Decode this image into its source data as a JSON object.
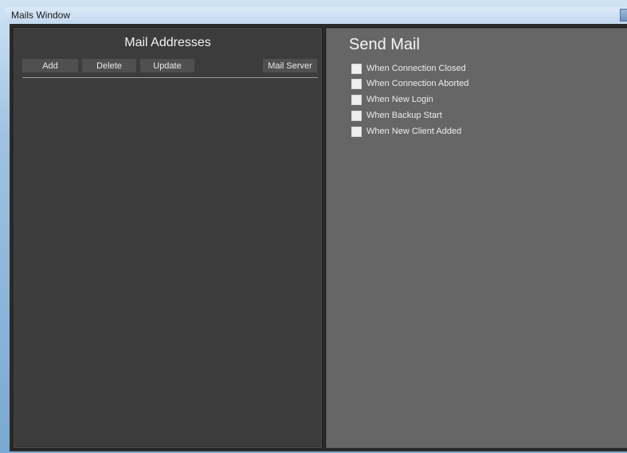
{
  "window": {
    "title": "Mails Window"
  },
  "mail_addresses": {
    "title": "Mail Addresses",
    "buttons": {
      "add": "Add",
      "delete": "Delete",
      "update": "Update",
      "mail_server": "Mail Server"
    },
    "items": []
  },
  "send_mail": {
    "title": "Send Mail",
    "options": [
      {
        "label": "When Connection Closed",
        "checked": false
      },
      {
        "label": "When Connection Aborted",
        "checked": false
      },
      {
        "label": "When New Login",
        "checked": false
      },
      {
        "label": "When Backup Start",
        "checked": false
      },
      {
        "label": "When New Client Added",
        "checked": false
      }
    ]
  },
  "colors": {
    "left_panel_bg": "#3c3c3c",
    "right_panel_bg": "#666666",
    "button_bg": "#505050",
    "text": "#f2f2f2"
  }
}
